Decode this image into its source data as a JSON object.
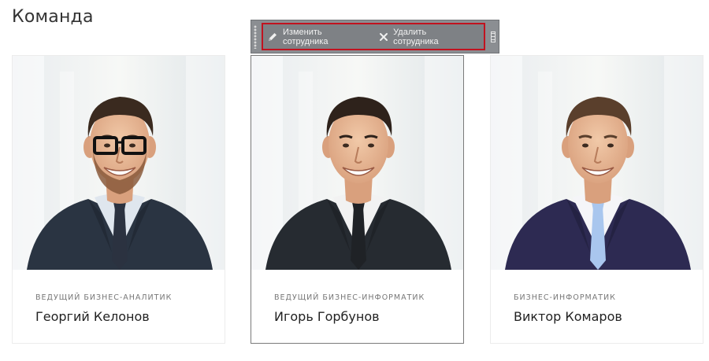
{
  "page": {
    "title": "Команда"
  },
  "toolbar": {
    "edit_label": "Изменить сотрудника",
    "delete_label": "Удалить сотрудника"
  },
  "colors": {
    "toolbar_bg": "#8b8e92",
    "highlight_border": "#c1121f"
  },
  "team": [
    {
      "role": "Ведущий бизнес-аналитик",
      "name": "Георгий Келонов",
      "suit": "#2a3442",
      "tie": "#2b3240",
      "shirt": "#dfe6ee",
      "hair": "#3a2a1f",
      "glasses": true,
      "beard": true
    },
    {
      "role": "Ведущий бизнес-информатик",
      "name": "Игорь Горбунов",
      "suit": "#262b31",
      "tie": "#1f2226",
      "shirt": "#f2f2f2",
      "hair": "#2e221b",
      "glasses": false,
      "beard": false
    },
    {
      "role": "Бизнес-информатик",
      "name": "Виктор Комаров",
      "suit": "#2d2a52",
      "tie": "#a9c6ee",
      "shirt": "#f5f5f8",
      "hair": "#5a3f2c",
      "glasses": false,
      "beard": false
    }
  ]
}
